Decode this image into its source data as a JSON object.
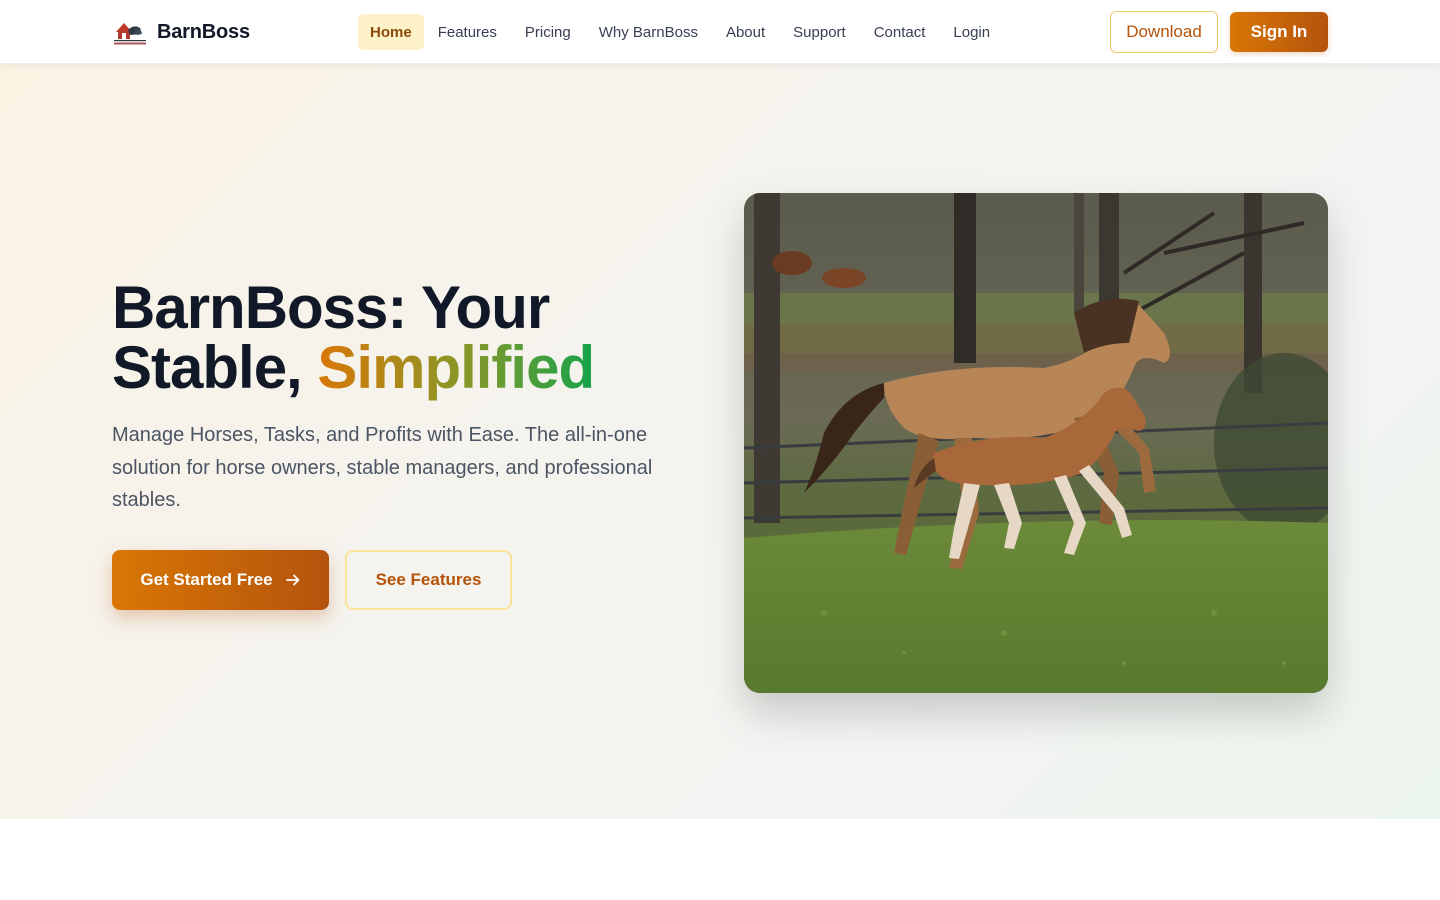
{
  "brand": {
    "name": "BarnBoss",
    "logo_icon": "barn-logo-icon"
  },
  "nav": {
    "items": [
      {
        "label": "Home",
        "active": true
      },
      {
        "label": "Features",
        "active": false
      },
      {
        "label": "Pricing",
        "active": false
      },
      {
        "label": "Why BarnBoss",
        "active": false
      },
      {
        "label": "About",
        "active": false
      },
      {
        "label": "Support",
        "active": false
      },
      {
        "label": "Contact",
        "active": false
      },
      {
        "label": "Login",
        "active": false
      }
    ]
  },
  "header_actions": {
    "download_label": "Download",
    "signin_label": "Sign In"
  },
  "hero": {
    "title_line1": "BarnBoss: Your",
    "title_line2_prefix": "Stable, ",
    "title_highlight": "Simplified",
    "subtitle": "Manage Horses, Tasks, and Profits with Ease. The all-in-one solution for horse owners, stable managers, and professional stables.",
    "cta_primary": "Get Started Free",
    "cta_primary_icon": "arrow-right-icon",
    "cta_secondary": "See Features",
    "image_subject": "horse-and-foal-photo"
  },
  "colors": {
    "accent": "#d97706",
    "accent_dark": "#b4530c",
    "highlight_green": "#16a34a",
    "active_nav_bg": "#fdf1c7",
    "text_dark": "#111827",
    "text_muted": "#4b5563"
  }
}
